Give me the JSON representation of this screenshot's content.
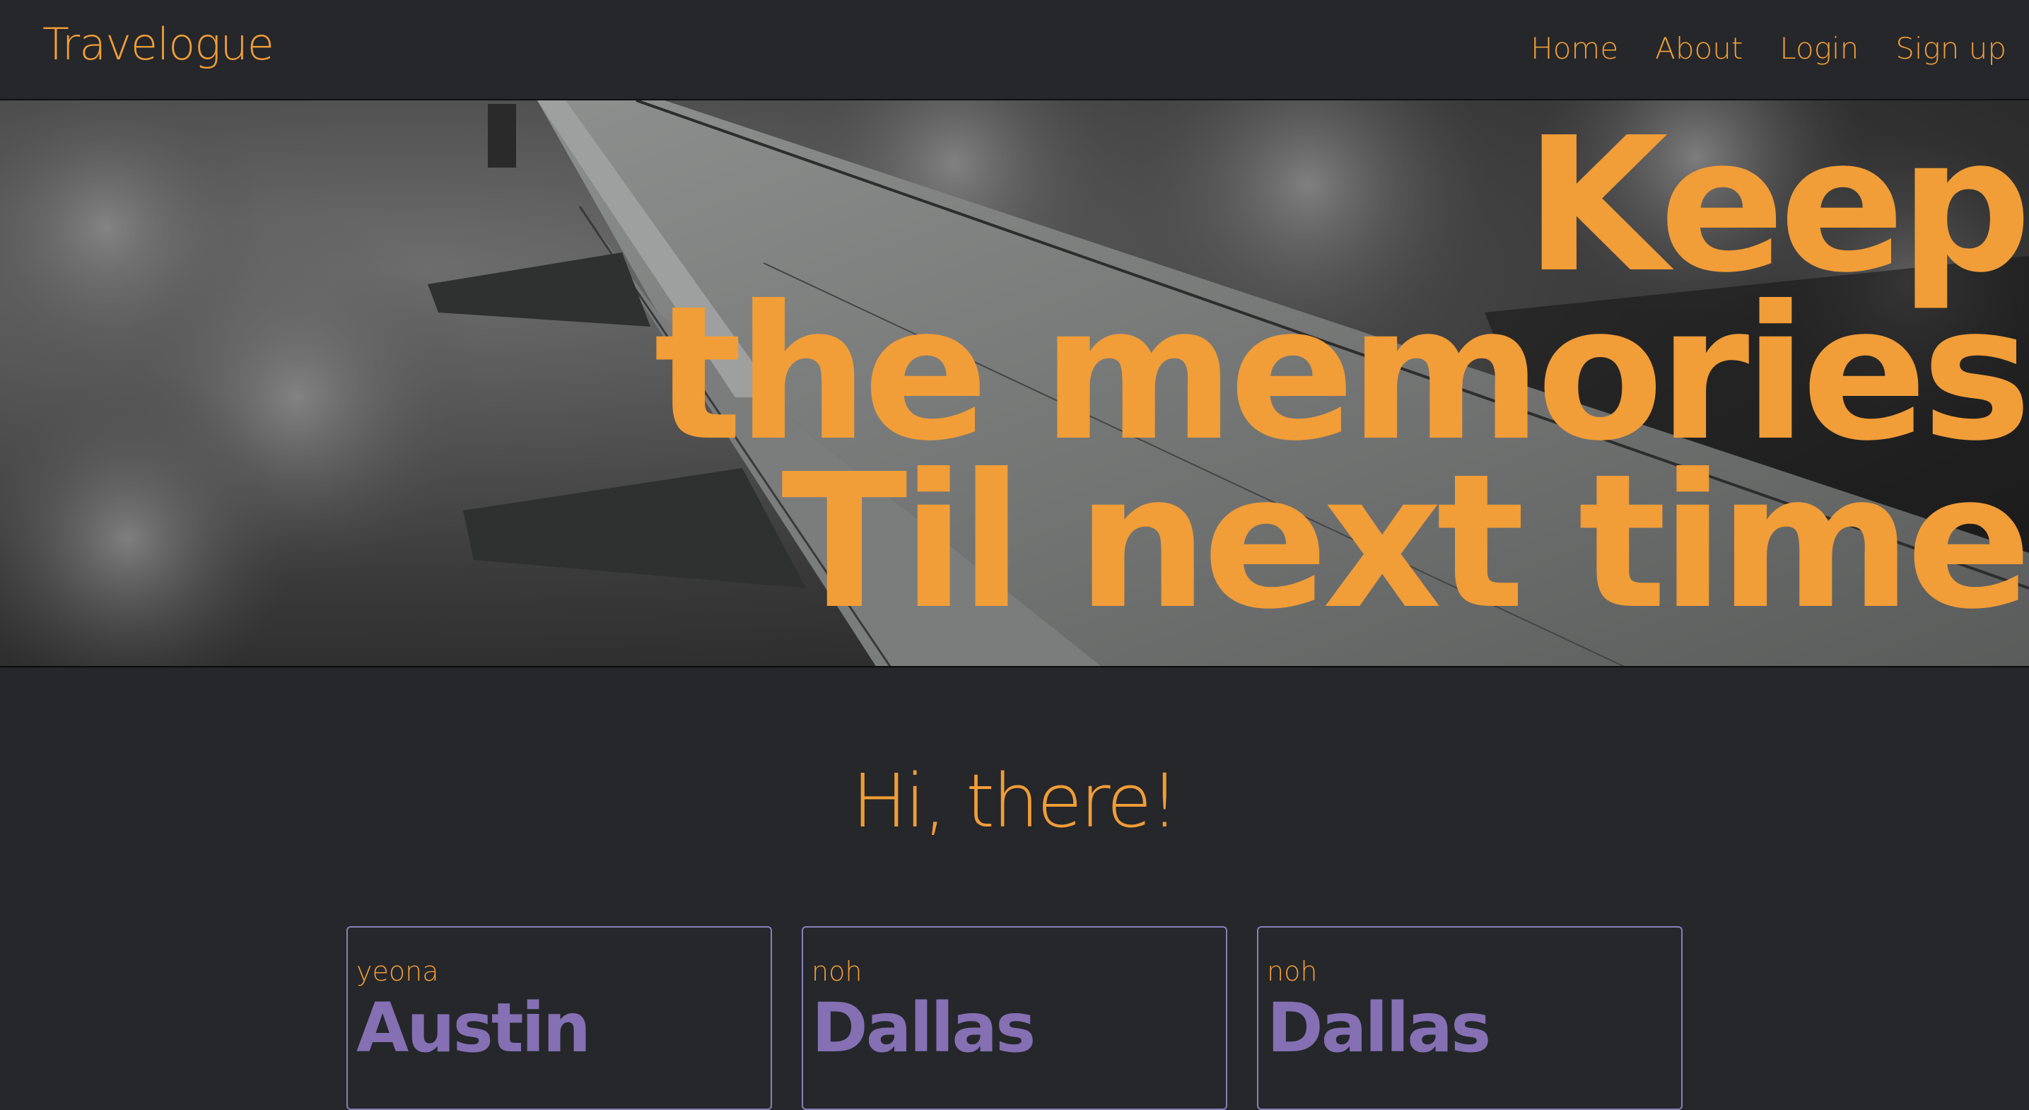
{
  "brand": "Travelogue",
  "nav": {
    "items": [
      {
        "label": "Home"
      },
      {
        "label": "About"
      },
      {
        "label": "Login"
      },
      {
        "label": "Sign up"
      }
    ]
  },
  "hero": {
    "lines": [
      "Keep",
      "the memories",
      "Til next time"
    ]
  },
  "greeting": "Hi, there!",
  "cards": [
    {
      "user": "yeona",
      "city": "Austin"
    },
    {
      "user": "noh",
      "city": "Dallas"
    },
    {
      "user": "noh",
      "city": "Dallas"
    }
  ],
  "colors": {
    "accent": "#f19d38",
    "card_title": "#8470b3",
    "card_border": "#8a7fbb",
    "background": "#25272a"
  }
}
